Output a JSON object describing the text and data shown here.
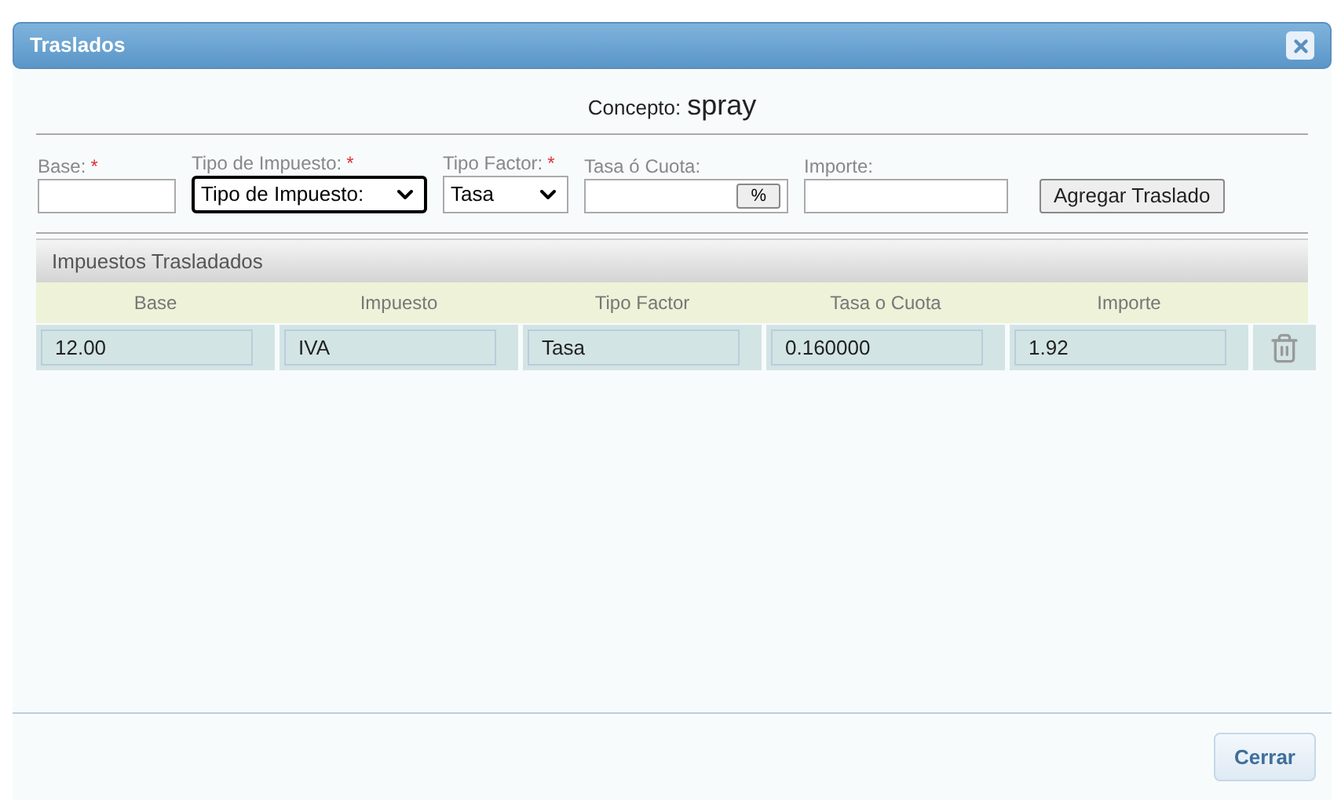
{
  "window": {
    "title": "Traslados"
  },
  "concepto": {
    "label": "Concepto:",
    "value": "spray"
  },
  "form": [
    {
      "kind": "input",
      "label": "Base:",
      "required_mark": "*"
    },
    {
      "kind": "select",
      "label": "Tipo de Impuesto:",
      "required_mark": "*",
      "value": "Tipo de Impuesto:",
      "focused": true
    },
    {
      "kind": "select",
      "label": "Tipo Factor:",
      "required_mark": "*",
      "value": "Tasa",
      "focused": false
    },
    {
      "kind": "input_button",
      "label": "Tasa ó Cuota:",
      "button": "%"
    },
    {
      "kind": "input",
      "label": "Importe:"
    }
  ],
  "add_button": "Agregar Traslado",
  "panel": {
    "title": "Impuestos Trasladados",
    "columns": [
      "Base",
      "Impuesto",
      "Tipo Factor",
      "Tasa o Cuota",
      "Importe"
    ],
    "rows": [
      [
        "12.00",
        "IVA",
        "Tasa",
        "0.160000",
        "1.92"
      ]
    ]
  },
  "close_button": "Cerrar"
}
